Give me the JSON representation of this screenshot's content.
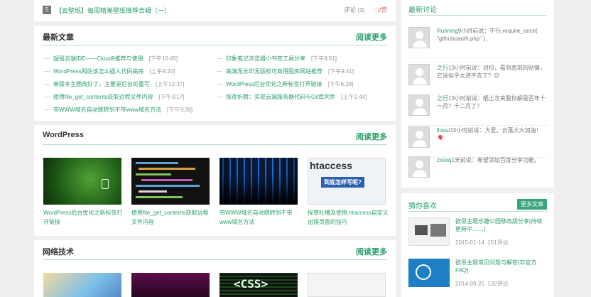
{
  "top_post": {
    "num": "5",
    "title": "【云壁纸】每周精美壁纸推荐合辑（一）",
    "comments": "评论 (3)",
    "likes": "2赞"
  },
  "latest": {
    "title": "最新文章",
    "more": "阅读更多",
    "items": [
      {
        "title": "超强云端IDE——Cloud9推荐与使用",
        "date": "[下午10:45]"
      },
      {
        "title": "印象笔记浏览器小书签工具分享",
        "date": "[下午8:51]"
      },
      {
        "title": "WordPress网站该怎么插入代码高亮",
        "date": "[上午9:20]"
      },
      {
        "title": "高清无水印无版权可商用图库网站推荐",
        "date": "[下午9:41]"
      },
      {
        "title": "新版本主题改好了，主要是后台的重写",
        "date": "[上午12:37]"
      },
      {
        "title": "WordPress后台优化之新标签打开链接",
        "date": "[下午6:28]"
      },
      {
        "title": "使用file_get_contents获取远程文件内容",
        "date": "[下午3:17]"
      },
      {
        "title": "探夜折腾：实现云端服务器代码与Git库同步",
        "date": "[上午1:44]"
      },
      {
        "title": "带WWW域名自动跳转到不带www域名方法",
        "date": "[下午3:30]"
      }
    ]
  },
  "wordpress": {
    "title": "WordPress",
    "more": "阅读更多",
    "items": [
      {
        "caption": "WordPress后台优化之新标签打开链接"
      },
      {
        "caption": "使用file_get_contents获取远程文件内容"
      },
      {
        "caption": "带WWW域名自动跳转到不带www域名方法"
      },
      {
        "caption": "探夜吐槽及使用.htaccess自定义出错页面的技巧",
        "thumb_text": "htaccess",
        "thumb_sub": "到底怎样写呢?"
      }
    ]
  },
  "network": {
    "title": "网络技术",
    "more": "阅读更多",
    "thumb_css_text": "<CSS>"
  },
  "discussion": {
    "title": "最新讨论",
    "items": [
      {
        "user": "Running",
        "text": "9小时前说：不行,require_once( \"githuboauth.php\" )..."
      },
      {
        "user": "之行",
        "text": "13小时前说：对拉，看到南部的贴情，它说似乎太进不去了？😊"
      },
      {
        "user": "之行",
        "text": "13小时前说：晒上次夹我你解是否年十一月？十二月了？"
      },
      {
        "user": "iluvut",
        "text": "15小时前说：大爱。云落大大加油！🎈"
      },
      {
        "user": "zxsxq",
        "text": "1天前说：希望添加百度分享功能。"
      }
    ]
  },
  "like": {
    "title": "猜你喜欢",
    "more": "更多文章",
    "items": [
      {
        "title": "欲思主题乐趣公园移改版分享[持续更新中……]",
        "date": "2015-01-14",
        "comments": "151评论"
      },
      {
        "title": "欲思主题常见问题与解答[非官方FAQ]",
        "date": "2014-09-25",
        "comments": "132评论"
      }
    ]
  }
}
